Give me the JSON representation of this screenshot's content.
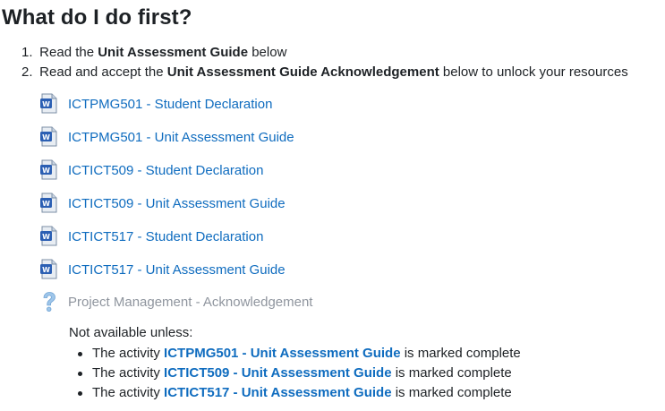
{
  "heading": "What do I do first?",
  "steps": [
    {
      "num": "1.",
      "pre": "Read the ",
      "bold": "Unit Assessment Guide",
      "post": " below"
    },
    {
      "num": "2.",
      "pre": "Read and accept the ",
      "bold": "Unit Assessment Guide Acknowledgement",
      "post": " below to unlock your resources"
    }
  ],
  "activities": [
    {
      "label": "ICTPMG501 - Student Declaration",
      "icon": "word-document-icon"
    },
    {
      "label": "ICTPMG501 - Unit Assessment Guide",
      "icon": "word-document-icon"
    },
    {
      "label": "ICTICT509 - Student Declaration",
      "icon": "word-document-icon"
    },
    {
      "label": "ICTICT509 - Unit Assessment Guide",
      "icon": "word-document-icon"
    },
    {
      "label": "ICTICT517 - Student Declaration",
      "icon": "word-document-icon"
    },
    {
      "label": "ICTICT517 - Unit Assessment Guide",
      "icon": "word-document-icon"
    },
    {
      "label": "Project Management - Acknowledgement",
      "icon": "question-icon"
    }
  ],
  "restriction": {
    "title": "Not available unless:",
    "conditions": [
      {
        "pre": "The activity ",
        "link": "ICTPMG501 - Unit Assessment Guide",
        "post": " is marked complete"
      },
      {
        "pre": "The activity ",
        "link": "ICTICT509 - Unit Assessment Guide",
        "post": " is marked complete"
      },
      {
        "pre": "The activity ",
        "link": "ICTICT517 - Unit Assessment Guide",
        "post": " is marked complete"
      }
    ]
  },
  "colors": {
    "link": "#0f6cbf",
    "disabled": "#8f959e",
    "text": "#1d2125"
  }
}
